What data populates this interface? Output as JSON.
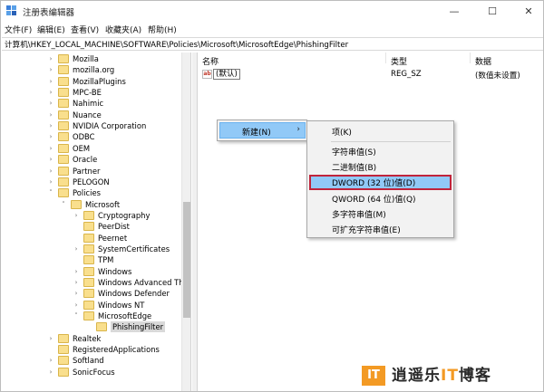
{
  "window": {
    "title": "注册表编辑器",
    "minimize_glyph": "—",
    "maximize_glyph": "☐",
    "close_glyph": "✕"
  },
  "menubar": {
    "items": [
      "文件(F)",
      "编辑(E)",
      "查看(V)",
      "收藏夹(A)",
      "帮助(H)"
    ]
  },
  "address": {
    "path": "计算机\\HKEY_LOCAL_MACHINE\\SOFTWARE\\Policies\\Microsoft\\MicrosoftEdge\\PhishingFilter"
  },
  "tree": {
    "items": [
      {
        "label": "Mozilla",
        "chevron": "›"
      },
      {
        "label": "mozilla.org",
        "chevron": "›"
      },
      {
        "label": "MozillaPlugins",
        "chevron": "›"
      },
      {
        "label": "MPC-BE",
        "chevron": "›"
      },
      {
        "label": "Nahimic",
        "chevron": "›"
      },
      {
        "label": "Nuance",
        "chevron": "›"
      },
      {
        "label": "NVIDIA Corporation",
        "chevron": "›"
      },
      {
        "label": "ODBC",
        "chevron": "›"
      },
      {
        "label": "OEM",
        "chevron": "›"
      },
      {
        "label": "Oracle",
        "chevron": "›"
      },
      {
        "label": "Partner",
        "chevron": "›"
      },
      {
        "label": "PELOGON",
        "chevron": "›"
      },
      {
        "label": "Policies",
        "chevron": "˅"
      },
      {
        "label": "Microsoft",
        "chevron": "˅"
      },
      {
        "label": "Cryptography",
        "chevron": "›"
      },
      {
        "label": "PeerDist",
        "chevron": ""
      },
      {
        "label": "Peernet",
        "chevron": ""
      },
      {
        "label": "SystemCertificates",
        "chevron": "›"
      },
      {
        "label": "TPM",
        "chevron": ""
      },
      {
        "label": "Windows",
        "chevron": "›"
      },
      {
        "label": "Windows Advanced Th",
        "chevron": "›"
      },
      {
        "label": "Windows Defender",
        "chevron": "›"
      },
      {
        "label": "Windows NT",
        "chevron": "›"
      },
      {
        "label": "MicrosoftEdge",
        "chevron": "˅"
      },
      {
        "label": "PhishingFilter",
        "chevron": ""
      },
      {
        "label": "Realtek",
        "chevron": "›"
      },
      {
        "label": "RegisteredApplications",
        "chevron": ""
      },
      {
        "label": "Softland",
        "chevron": "›"
      },
      {
        "label": "SonicFocus",
        "chevron": "›"
      }
    ]
  },
  "list": {
    "columns": {
      "name": "名称",
      "type": "类型",
      "data": "数据"
    },
    "rows": [
      {
        "icon": "ab",
        "name": "(默认)",
        "type": "REG_SZ",
        "data": "(数值未设置)"
      }
    ]
  },
  "context_menu": {
    "item": "新建(N)",
    "arrow": "›"
  },
  "submenu": {
    "items": [
      "项(K)",
      "字符串值(S)",
      "二进制值(B)",
      "DWORD (32 位)值(D)",
      "QWORD (64 位)值(Q)",
      "多字符串值(M)",
      "可扩充字符串值(E)"
    ],
    "highlighted_index": 3
  },
  "logo": {
    "mark": "IT",
    "text_a": "逍遥乐",
    "text_accent": "IT",
    "text_b": "博客"
  },
  "colors": {
    "highlight": "#91c9f7",
    "highlight_border": "#c0243b",
    "folder": "#f9df8d",
    "logo_accent": "#f39a24"
  }
}
